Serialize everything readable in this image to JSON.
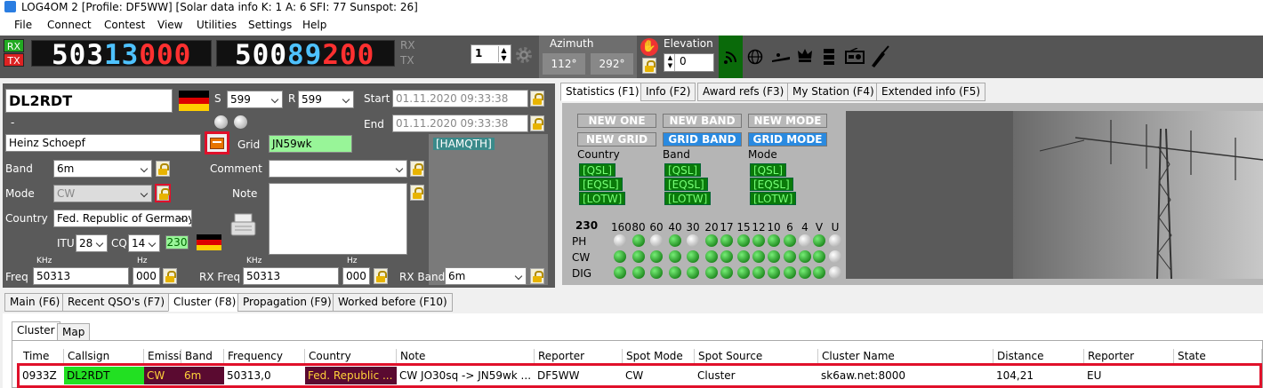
{
  "window": {
    "title": "LOG4OM 2 [Profile: DF5WW] [Solar data info K: 1 A: 6 SFI: 77 Sunspot: 26]"
  },
  "menu": [
    "File",
    "Connect",
    "Contest",
    "View",
    "Utilities",
    "Settings",
    "Help"
  ],
  "radio": {
    "rx_label": "RX",
    "tx_label": "TX",
    "vfo_a_white": "503",
    "vfo_a_blue": "13",
    "vfo_a_red": "000",
    "vfo_b_white": "500",
    "vfo_b_blue": "89",
    "vfo_b_red": "200",
    "rx2_label": "RX",
    "tx2_label": "TX",
    "memory": "1",
    "azimuth_label": "Azimuth",
    "azimuth_1": "112°",
    "azimuth_2": "292°",
    "elevation_label": "Elevation",
    "elevation": "0"
  },
  "qso": {
    "callsign": "DL2RDT",
    "s_label": "S",
    "s_value": "599",
    "r_label": "R",
    "r_value": "599",
    "start_label": "Start",
    "start": "01.11.2020 09:33:38",
    "end_label": "End",
    "end": "01.11.2020 09:33:38",
    "dash": "-",
    "name": "Heinz Schoepf",
    "grid_label": "Grid",
    "grid": "JN59wk",
    "hamqth": "[HAMQTH]",
    "band_label": "Band",
    "band": "6m",
    "comment_label": "Comment",
    "comment": "",
    "mode_label": "Mode",
    "mode": "CW",
    "note_label": "Note",
    "country_label": "Country",
    "country": "Fed. Republic of Germany",
    "itu_label": "ITU",
    "itu": "28",
    "cq_label": "CQ",
    "cq": "14",
    "dxcc": "230",
    "freq_label": "Freq",
    "khz_label": "KHz",
    "hz_label": "Hz",
    "freq_khz": "50313",
    "freq_hz": "000",
    "rxfreq_label": "RX Freq",
    "rx_khz_label": "KHz",
    "rx_hz_label": "Hz",
    "rxfreq_khz": "50313",
    "rxfreq_hz": "000",
    "rxband_label": "RX Band",
    "rxband": "6m"
  },
  "info_tabs": [
    "Statistics (F1)",
    "Info (F2)",
    "Award refs (F3)",
    "My Station (F4)",
    "Extended info (F5)"
  ],
  "stats": {
    "new_one": "NEW ONE",
    "new_band": "NEW BAND",
    "new_mode": "NEW MODE",
    "new_grid": "NEW GRID",
    "grid_band": "GRID BAND",
    "grid_mode": "GRID MODE",
    "country_label": "Country",
    "band_label": "Band",
    "mode_label": "Mode",
    "qsl": "[QSL]",
    "eqsl": "[EQSL]",
    "lotw": "[LOTW]",
    "dxcc_number": "230",
    "band_headers": [
      "160",
      "80",
      "60",
      "40",
      "30",
      "20",
      "17",
      "15",
      "12",
      "10",
      "6",
      "4",
      "V",
      "U"
    ],
    "rows": [
      {
        "label": "PH",
        "dots": [
          "w",
          "g",
          "w",
          "g",
          "w",
          "g",
          "g",
          "g",
          "g",
          "g",
          "g",
          "w",
          "g",
          "w"
        ]
      },
      {
        "label": "CW",
        "dots": [
          "g",
          "g",
          "g",
          "g",
          "g",
          "g",
          "g",
          "g",
          "g",
          "g",
          "g",
          "g",
          "g",
          "w"
        ]
      },
      {
        "label": "DIG",
        "dots": [
          "g",
          "g",
          "g",
          "g",
          "g",
          "g",
          "g",
          "g",
          "g",
          "g",
          "g",
          "g",
          "g",
          "w"
        ]
      }
    ]
  },
  "bottom_tabs": [
    "Main (F6)",
    "Recent QSO's (F7)",
    "Cluster (F8)",
    "Propagation (F9)",
    "Worked before (F10)"
  ],
  "cluster_tabs": [
    "Cluster",
    "Map"
  ],
  "cluster": {
    "headers": [
      "Time",
      "Callsign",
      "Emissi",
      "Band",
      "Frequency",
      "Country",
      "Note",
      "Reporter",
      "Spot Mode",
      "Spot Source",
      "Cluster Name",
      "Distance",
      "Reporter",
      "State"
    ],
    "row": [
      "0933Z",
      "DL2RDT",
      "CW",
      "6m",
      "50313,0",
      "Fed. Republic ...",
      "CW JO30sq -> JN59wk ...",
      "DF5WW",
      "CW",
      "Cluster",
      "sk6aw.net:8000",
      "104,21",
      "EU",
      ""
    ]
  },
  "colors": {
    "highlight_red": "#e0102a",
    "callsign_green": "#22e022",
    "maroon": "#5a0a30",
    "blue_btn": "#2a8ae0"
  }
}
